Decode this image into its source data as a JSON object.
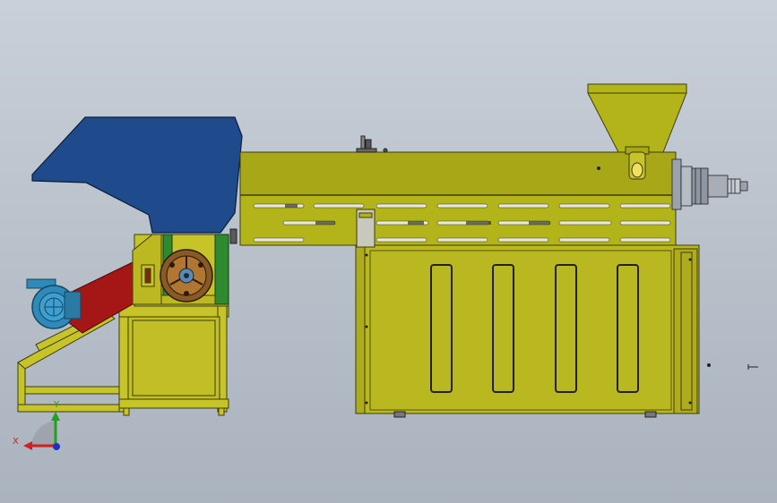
{
  "view": {
    "background_top": "#c9d0d9",
    "background_bottom": "#aab3be"
  },
  "colors": {
    "hopper_blue": "#1f4b8c",
    "body_olive": "#b3b31a",
    "frame_yellow": "#c7c42a",
    "belt_red": "#a51616",
    "motor_cyan": "#2e8ab8",
    "green_guard": "#2f8a2f",
    "wheel_brown": "#8a5a26"
  },
  "axis_triad": {
    "x_label": "X",
    "y_label": "Y",
    "x_color": "#d02020",
    "y_color": "#20a020",
    "z_color": "#2030c0"
  }
}
